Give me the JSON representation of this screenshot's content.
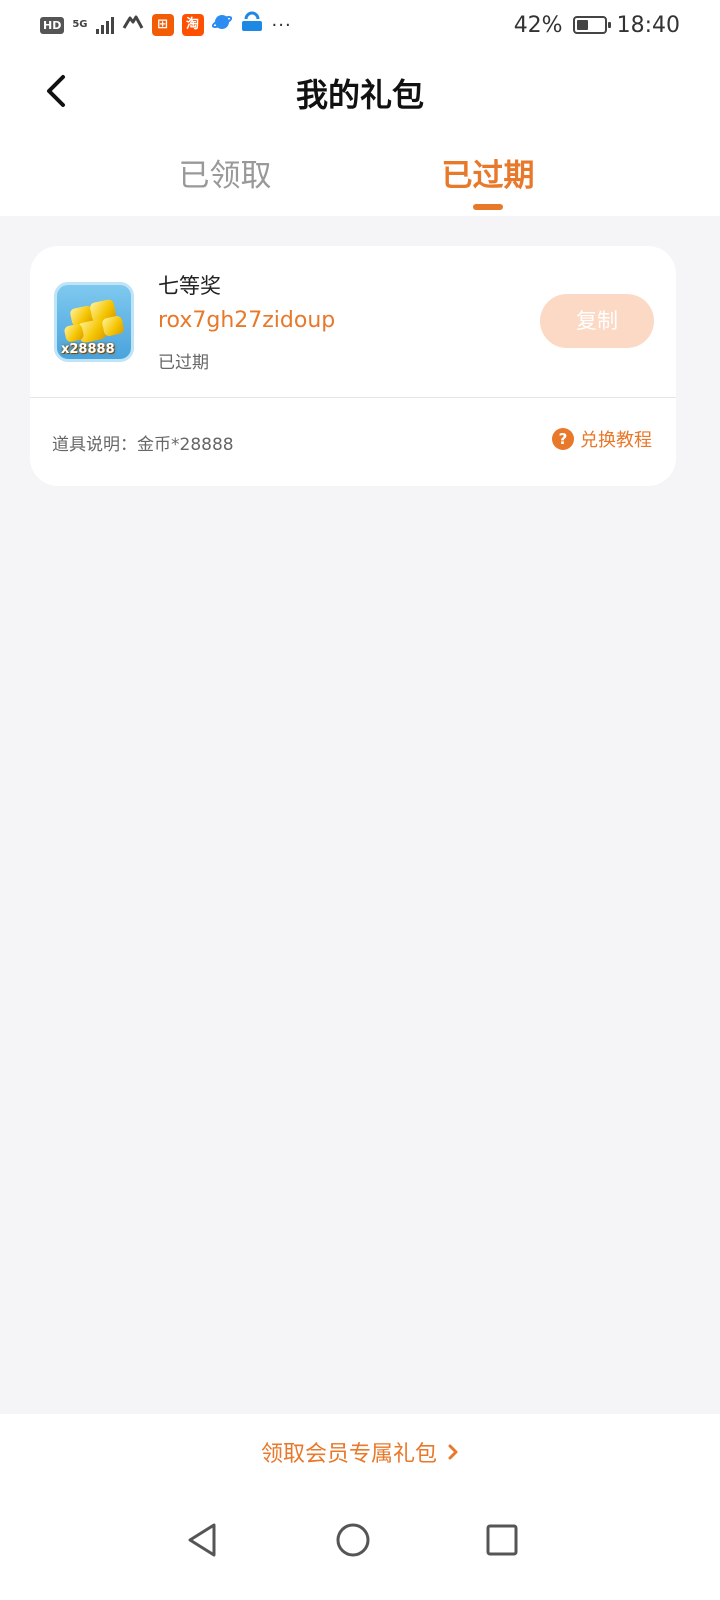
{
  "status_bar": {
    "hd": "HD",
    "network": "5G",
    "battery_percent": "42%",
    "battery_level": 0.42,
    "time": "18:40",
    "more": "···"
  },
  "header": {
    "title": "我的礼包",
    "back_icon": "chevron-left-icon"
  },
  "tabs": [
    {
      "label": "已领取",
      "active": false
    },
    {
      "label": "已过期",
      "active": true
    }
  ],
  "gift": {
    "name": "七等奖",
    "code": "rox7gh27zidoup",
    "status": "已过期",
    "icon_quantity": "x28888",
    "copy_label": "复制",
    "description": "道具说明：金币*28888",
    "tutorial_label": "兑换教程",
    "tutorial_icon": "?"
  },
  "bottom_link": {
    "label": "领取会员专属礼包"
  },
  "colors": {
    "accent": "#e8782a",
    "copy_disabled_bg": "#fbd9c4",
    "page_bg": "#f5f5f7"
  }
}
